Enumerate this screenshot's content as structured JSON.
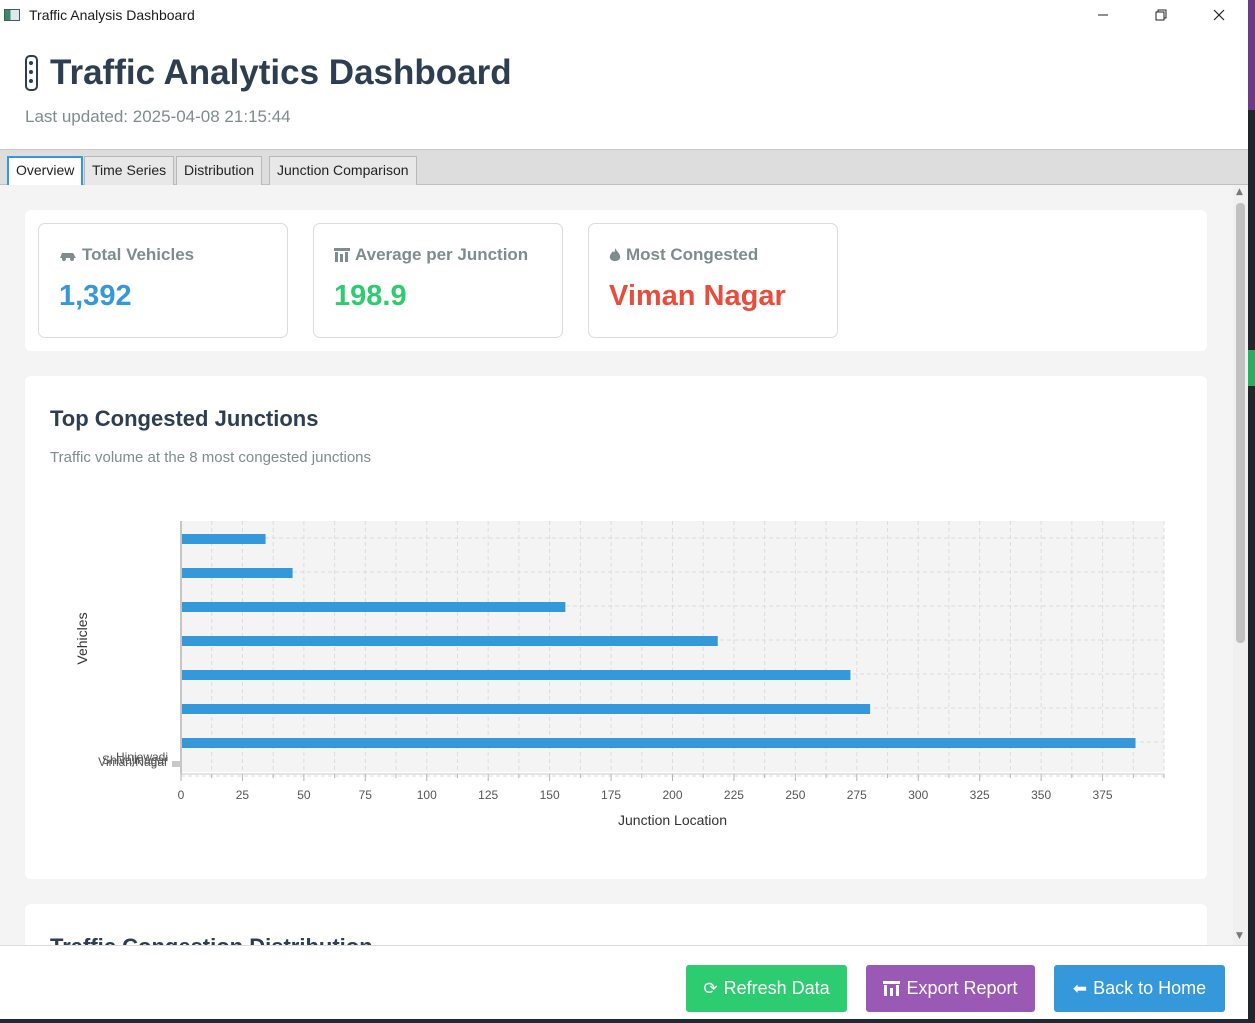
{
  "window": {
    "title": "Traffic Analysis Dashboard"
  },
  "header": {
    "title": "Traffic Analytics Dashboard",
    "updated": "Last updated: 2025-04-08 21:15:44"
  },
  "tabs": [
    {
      "label": "Overview",
      "active": true
    },
    {
      "label": "Time Series",
      "active": false
    },
    {
      "label": "Distribution",
      "active": false
    },
    {
      "label": "Junction Comparison",
      "active": false
    }
  ],
  "stats": [
    {
      "label": "Total Vehicles",
      "value": "1,392",
      "icon": "car-icon",
      "color": "#3498db"
    },
    {
      "label": "Average per Junction",
      "value": "198.9",
      "icon": "chart-icon",
      "color": "#2ecc71"
    },
    {
      "label": "Most Congested",
      "value": "Viman Nagar",
      "icon": "fire-icon",
      "color": "#e74c3c"
    }
  ],
  "chart": {
    "title": "Top Congested Junctions",
    "subtitle": "Traffic volume at the 8 most congested junctions"
  },
  "chart_data": {
    "type": "bar",
    "orientation": "horizontal",
    "values": [
      34,
      45,
      156,
      218,
      272,
      280,
      388
    ],
    "overlapping_category_labels": [
      "Hinjewadi",
      "Shivajinagar",
      "Viman Nagar"
    ],
    "xlabel": "Junction Location",
    "ylabel": "Vehicles",
    "xlim": [
      0,
      400
    ],
    "xticks": [
      0,
      25,
      50,
      75,
      100,
      125,
      150,
      175,
      200,
      225,
      250,
      275,
      300,
      325,
      350,
      375
    ],
    "color": "#3498db",
    "grid": true
  },
  "distribution": {
    "title": "Traffic Congestion Distribution"
  },
  "footer": {
    "refresh": "Refresh Data",
    "export": "Export Report",
    "home": "Back to Home"
  },
  "colors": {
    "accent": "#3498db",
    "success": "#2ecc71",
    "purple": "#9b59b6",
    "danger": "#e74c3c",
    "heading": "#2c3e50"
  }
}
